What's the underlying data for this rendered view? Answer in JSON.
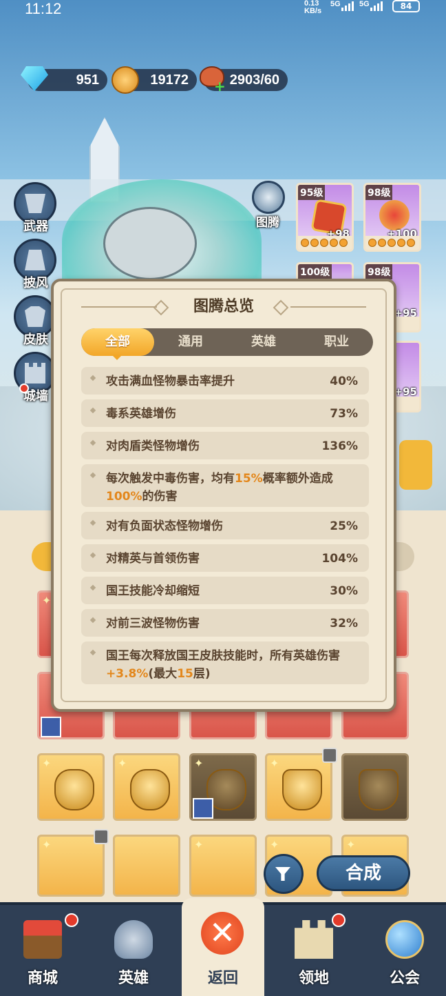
{
  "status_bar": {
    "time": "11:12",
    "net_speed": "0.13",
    "net_unit": "KB/s",
    "net1": "5G",
    "net2": "5G",
    "battery": "84"
  },
  "currency": {
    "diamond": "951",
    "coin": "19172",
    "stamina": "2903/60"
  },
  "side_menu": [
    {
      "label": "武器",
      "icon": "weapon-icon"
    },
    {
      "label": "披风",
      "icon": "cape-icon"
    },
    {
      "label": "皮肤",
      "icon": "skin-icon"
    },
    {
      "label": "城墙",
      "icon": "wall-icon"
    }
  ],
  "totem_button": {
    "label": "图腾",
    "icon": "totem-icon"
  },
  "totem_cards": [
    {
      "level": "95级",
      "plus": "+98"
    },
    {
      "level": "98级",
      "plus": "+100"
    },
    {
      "level": "100级",
      "plus": ""
    },
    {
      "level": "98级",
      "plus": "+95"
    },
    {
      "level": "",
      "plus": "+95"
    }
  ],
  "modal": {
    "title": "图腾总览",
    "tabs": [
      "全部",
      "通用",
      "英雄",
      "职业"
    ],
    "active_tab": "全部",
    "rows": [
      {
        "text": "攻击满血怪物暴击率提升",
        "value": "40%"
      },
      {
        "text": "毒系英雄增伤",
        "value": "73%"
      },
      {
        "text": "对肉盾类怪物增伤",
        "value": "136%"
      },
      {
        "t1": "每次触发中毒伤害，均有",
        "h1": "15%",
        "t2": "概率额外造成",
        "h2": "100%",
        "t3": "的伤害"
      },
      {
        "text": "对有负面状态怪物增伤",
        "value": "25%"
      },
      {
        "text": "对精英与首领伤害",
        "value": "104%"
      },
      {
        "text": "国王技能冷却缩短",
        "value": "30%"
      },
      {
        "text": "对前三波怪物伤害",
        "value": "32%"
      },
      {
        "t1": "国王每次释放国王皮肤技能时，所有英雄伤害",
        "h1": "+3.8%",
        "t2": "(最大",
        "h2": "15",
        "t3": "层)"
      }
    ]
  },
  "synth_button": "合成",
  "nav": [
    {
      "label": "商城",
      "icon": "shop-icon"
    },
    {
      "label": "英雄",
      "icon": "helmet-icon"
    },
    {
      "label": "返回",
      "icon": "close-icon"
    },
    {
      "label": "领地",
      "icon": "castle-icon"
    },
    {
      "label": "公会",
      "icon": "planet-icon"
    }
  ],
  "colors": {
    "accent": "#f2a628",
    "highlight": "#e3871c",
    "nav_bg": "#2f3f55"
  }
}
